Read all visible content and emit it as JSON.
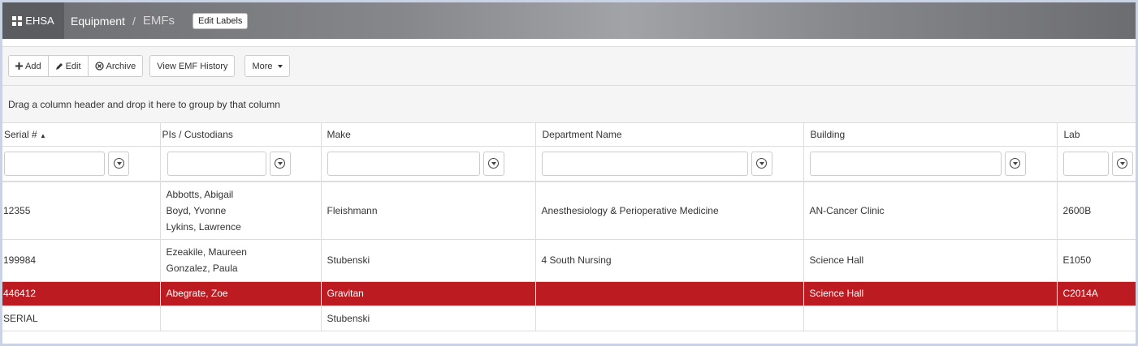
{
  "header": {
    "brand": "EHSA",
    "breadcrumb": [
      "Equipment",
      "/",
      "EMFs"
    ],
    "edit_labels": "Edit Labels"
  },
  "toolbar": {
    "add": "Add",
    "edit": "Edit",
    "archive": "Archive",
    "history": "View EMF History",
    "more": "More"
  },
  "group_hint": "Drag a column header and drop it here to group by that column",
  "grid": {
    "columns": [
      "Serial #",
      "PIs / Custodians",
      "Make",
      "Department Name",
      "Building",
      "Lab"
    ],
    "sort_indicator": "▲",
    "rows": [
      {
        "serial": "12355",
        "pis": [
          "Abbotts, Abigail",
          "Boyd, Yvonne",
          "Lykins, Lawrence"
        ],
        "make": "Fleishmann",
        "department": "Anesthesiology & Perioperative Medicine",
        "building": "AN-Cancer Clinic",
        "lab": "2600B"
      },
      {
        "serial": "199984",
        "pis": [
          "Ezeakile, Maureen",
          "Gonzalez, Paula"
        ],
        "make": "Stubenski",
        "department": "4 South Nursing",
        "building": "Science Hall",
        "lab": "E1050"
      },
      {
        "serial": "446412",
        "pis": [
          "Abegrate, Zoe"
        ],
        "make": "Gravitan",
        "department": "",
        "building": "Science Hall",
        "lab": "C2014A"
      },
      {
        "serial": "SERIAL",
        "pis": [
          ""
        ],
        "make": "Stubenski",
        "department": "",
        "building": "",
        "lab": ""
      }
    ]
  },
  "colors": {
    "selected_row": "#bc1b22",
    "header_bar": "#86878b"
  },
  "icons": [
    "grid-icon",
    "plus-icon",
    "pencil-icon",
    "archive-icon",
    "caret-down-icon",
    "filter-icon"
  ]
}
